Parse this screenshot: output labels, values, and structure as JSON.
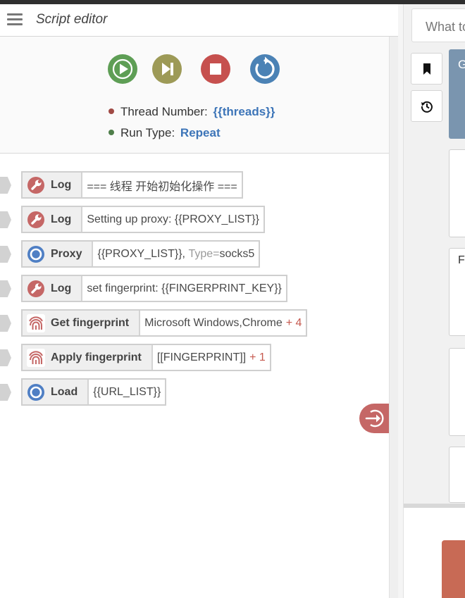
{
  "editor": {
    "title": "Script editor",
    "controls": {
      "play": "play-icon",
      "step": "step-forward-icon",
      "stop": "stop-icon",
      "restart": "restart-icon"
    },
    "info": {
      "thread_label": "Thread Number:",
      "thread_value": "{{threads}}",
      "run_label": "Run Type:",
      "run_value": "Repeat"
    },
    "commands": [
      {
        "icon": "wrench-icon",
        "name": "Log",
        "param": "=== 线程 开始初始化操作 ==="
      },
      {
        "icon": "wrench-icon",
        "name": "Log",
        "param": "Setting up proxy: {{PROXY_LIST}}"
      },
      {
        "icon": "globe-icon",
        "name": "Proxy",
        "param": "{{PROXY_LIST}},",
        "param_key": "Type=",
        "param_value": "socks5"
      },
      {
        "icon": "wrench-icon",
        "name": "Log",
        "param": "set fingerprint: {{FINGERPRINT_KEY}}"
      },
      {
        "icon": "fingerprint-icon",
        "name": "Get fingerprint",
        "param": "Microsoft Windows,Chrome",
        "extra": "+ 4"
      },
      {
        "icon": "fingerprint-icon",
        "name": "Apply fingerprint",
        "param": "[[FINGERPRINT]]",
        "extra": "+ 1"
      },
      {
        "icon": "globe-icon",
        "name": "Load",
        "param": "{{URL_LIST}}"
      }
    ]
  },
  "right_panel": {
    "search_placeholder": "What to",
    "blue_card_letter": "G",
    "card2_letter": "F"
  },
  "colors": {
    "play": "#5e9e55",
    "step": "#9d9a57",
    "stop": "#c6504e",
    "restart": "#4b82b5",
    "link_blue": "#3d75b8",
    "extra_red": "#c65a4f",
    "side_arrow": "#c56766"
  }
}
